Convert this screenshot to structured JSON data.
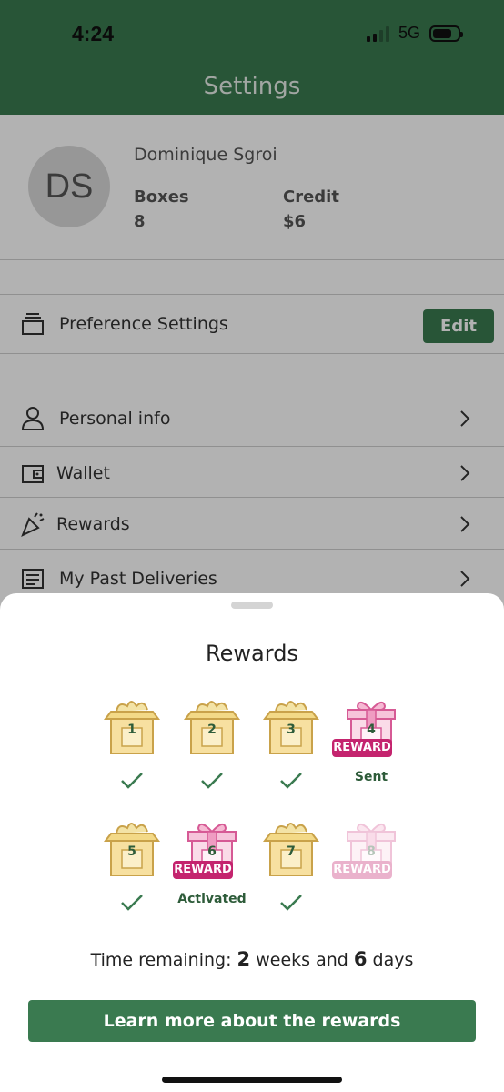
{
  "status_bar": {
    "time": "4:24",
    "network": "5G"
  },
  "header": {
    "title": "Settings"
  },
  "profile": {
    "initials": "DS",
    "name": "Dominique Sgroi",
    "boxes_label": "Boxes",
    "boxes_value": "8",
    "credit_label": "Credit",
    "credit_value": "$6"
  },
  "preferences": {
    "label": "Preference Settings",
    "edit_label": "Edit"
  },
  "menu": [
    {
      "label": "Personal info",
      "icon": "person-icon"
    },
    {
      "label": "Wallet",
      "icon": "wallet-icon"
    },
    {
      "label": "Rewards",
      "icon": "party-popper-icon"
    },
    {
      "label": "My Past Deliveries",
      "icon": "receipt-icon"
    }
  ],
  "sheet": {
    "title": "Rewards",
    "boxes": [
      {
        "number": "1",
        "type": "box",
        "status": "check"
      },
      {
        "number": "2",
        "type": "box",
        "status": "check"
      },
      {
        "number": "3",
        "type": "box",
        "status": "check"
      },
      {
        "number": "4",
        "type": "gift",
        "badge": "REWARD",
        "status_text": "Sent"
      },
      {
        "number": "5",
        "type": "box",
        "status": "check"
      },
      {
        "number": "6",
        "type": "gift",
        "badge": "REWARD",
        "status_text": "Activated"
      },
      {
        "number": "7",
        "type": "box",
        "status": "check"
      },
      {
        "number": "8",
        "type": "gift",
        "badge": "REWARD",
        "faded": true
      }
    ],
    "time_prefix": "Time remaining: ",
    "time_weeks": "2",
    "time_weeks_label": " weeks and ",
    "time_days": "6",
    "time_days_label": " days",
    "learn_more": "Learn more about the rewards"
  },
  "colors": {
    "brand_green": "#3a7a50",
    "reward_pink": "#c4246e",
    "box_gold": "#e8c66a"
  }
}
